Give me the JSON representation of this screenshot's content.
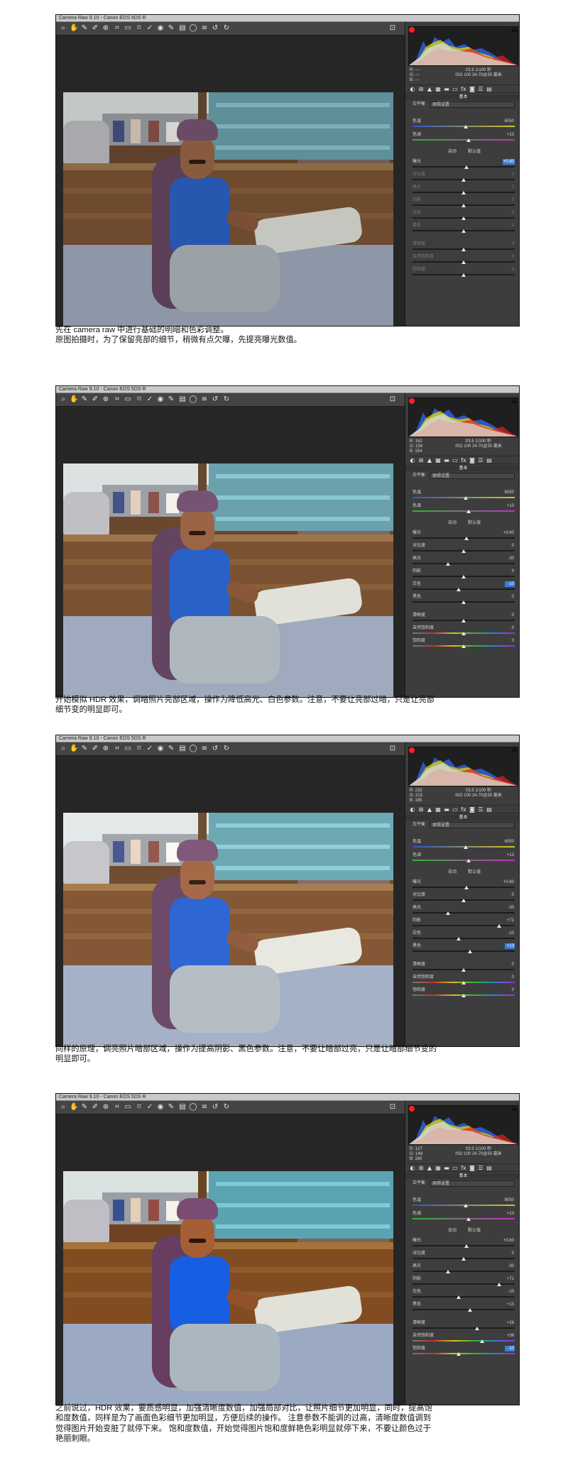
{
  "window_title": "Camera Raw 9.10 - Canon EOS 5DS R",
  "toolbar_icons": [
    "zoom-icon",
    "hand-icon",
    "white-balance-icon",
    "color-sampler-icon",
    "target-adjust-icon",
    "crop-icon",
    "straighten-icon",
    "transform-icon",
    "spot-removal-icon",
    "red-eye-icon",
    "adjustment-brush-icon",
    "graduated-filter-icon",
    "radial-filter-icon",
    "preferences-icon",
    "rotate-left-icon",
    "rotate-right-icon",
    "fullscreen-icon"
  ],
  "panel_tab_icons": [
    "basic-icon",
    "tone-curve-icon",
    "detail-icon",
    "hsl-icon",
    "split-toning-icon",
    "lens-icon",
    "effects-icon",
    "calibration-icon",
    "presets-icon",
    "snapshots-icon"
  ],
  "panel_title": "基本",
  "white_balance_label": "白平衡",
  "white_balance_value": "原照设置",
  "auto_label": "自动",
  "default_label": "默认值",
  "colors": {
    "highlight": "#3b7de0",
    "clip_warning": "#ff2020"
  },
  "sections": [
    {
      "info": {
        "r": "R: ---",
        "g": "G: ---",
        "b": "B: ---",
        "exposure": "f/3.5  1/100 秒",
        "iso": "ISO 100  24-70@35 毫米"
      },
      "sliders": [
        {
          "label": "色温",
          "value": "6050",
          "level": 0.52,
          "dim": false,
          "hl": false
        },
        {
          "label": "色调",
          "value": "+13",
          "level": 0.55,
          "dim": false,
          "hl": false
        },
        {
          "label": "曝光",
          "value": "+0.60",
          "level": 0.53,
          "dim": false,
          "hl": true
        },
        {
          "label": "对比度",
          "value": "0",
          "level": 0.5,
          "dim": true,
          "hl": false
        },
        {
          "label": "高光",
          "value": "0",
          "level": 0.5,
          "dim": true,
          "hl": false
        },
        {
          "label": "阴影",
          "value": "0",
          "level": 0.5,
          "dim": true,
          "hl": false
        },
        {
          "label": "白色",
          "value": "0",
          "level": 0.5,
          "dim": true,
          "hl": false
        },
        {
          "label": "黑色",
          "value": "0",
          "level": 0.5,
          "dim": true,
          "hl": false
        },
        {
          "label": "清晰度",
          "value": "0",
          "level": 0.5,
          "dim": true,
          "hl": false
        },
        {
          "label": "自然饱和度",
          "value": "0",
          "level": 0.5,
          "dim": true,
          "hl": false
        },
        {
          "label": "饱和度",
          "value": "0",
          "level": 0.5,
          "dim": true,
          "hl": false
        }
      ],
      "caption": "先在 camera raw 中进行基础的明暗和色彩调整。\n原图拍摄时，为了保留亮部的细节，稍微有点欠曝，先提亮曝光数值。"
    },
    {
      "info": {
        "r": "R: 162",
        "g": "G: 156",
        "b": "B: 154",
        "exposure": "f/3.5  1/100 秒",
        "iso": "ISO 100  24-70@35 毫米"
      },
      "sliders": [
        {
          "label": "色温",
          "value": "6050",
          "level": 0.52,
          "dim": false,
          "hl": false
        },
        {
          "label": "色调",
          "value": "+13",
          "level": 0.55,
          "dim": false,
          "hl": false
        },
        {
          "label": "曝光",
          "value": "+0.60",
          "level": 0.53,
          "dim": false,
          "hl": false
        },
        {
          "label": "对比度",
          "value": "0",
          "level": 0.5,
          "dim": false,
          "hl": false
        },
        {
          "label": "高光",
          "value": "-30",
          "level": 0.35,
          "dim": false,
          "hl": false
        },
        {
          "label": "阴影",
          "value": "0",
          "level": 0.5,
          "dim": false,
          "hl": false
        },
        {
          "label": "白色",
          "value": "-10",
          "level": 0.45,
          "dim": false,
          "hl": true
        },
        {
          "label": "黑色",
          "value": "0",
          "level": 0.5,
          "dim": false,
          "hl": false
        },
        {
          "label": "清晰度",
          "value": "0",
          "level": 0.5,
          "dim": false,
          "hl": false
        },
        {
          "label": "自然饱和度",
          "value": "0",
          "level": 0.5,
          "dim": false,
          "hl": false
        },
        {
          "label": "饱和度",
          "value": "0",
          "level": 0.5,
          "dim": false,
          "hl": false
        }
      ],
      "caption": "开始模拟 HDR 效果，调暗照片亮部区域，操作为降低高光、白色参数。注意，不要让亮部过暗，只是让亮部\n细节变的明显即可。"
    },
    {
      "info": {
        "r": "R: 232",
        "g": "G: 213",
        "b": "B: 185",
        "exposure": "f/3.5  1/100 秒",
        "iso": "ISO 100  24-70@35 毫米"
      },
      "sliders": [
        {
          "label": "色温",
          "value": "6050",
          "level": 0.52,
          "dim": false,
          "hl": false
        },
        {
          "label": "色调",
          "value": "+13",
          "level": 0.55,
          "dim": false,
          "hl": false
        },
        {
          "label": "曝光",
          "value": "+0.60",
          "level": 0.53,
          "dim": false,
          "hl": false
        },
        {
          "label": "对比度",
          "value": "0",
          "level": 0.5,
          "dim": false,
          "hl": false
        },
        {
          "label": "高光",
          "value": "-30",
          "level": 0.35,
          "dim": false,
          "hl": false
        },
        {
          "label": "阴影",
          "value": "+71",
          "level": 0.85,
          "dim": false,
          "hl": false
        },
        {
          "label": "白色",
          "value": "-10",
          "level": 0.45,
          "dim": false,
          "hl": false
        },
        {
          "label": "黑色",
          "value": "+13",
          "level": 0.56,
          "dim": false,
          "hl": true
        },
        {
          "label": "清晰度",
          "value": "0",
          "level": 0.5,
          "dim": false,
          "hl": false
        },
        {
          "label": "自然饱和度",
          "value": "0",
          "level": 0.5,
          "dim": false,
          "hl": false
        },
        {
          "label": "饱和度",
          "value": "0",
          "level": 0.5,
          "dim": false,
          "hl": false
        }
      ],
      "caption": "同样的原理，调亮照片暗部区域，操作为提高阴影、黑色参数。注意，不要让暗部过亮，只是让暗部细节变的\n明显即可。"
    },
    {
      "info": {
        "r": "R: 127",
        "g": "G: 148",
        "b": "B: 160",
        "exposure": "f/3.5  1/100 秒",
        "iso": "ISO 100  24-70@35 毫米"
      },
      "sliders": [
        {
          "label": "色温",
          "value": "6050",
          "level": 0.52,
          "dim": false,
          "hl": false
        },
        {
          "label": "色调",
          "value": "+13",
          "level": 0.55,
          "dim": false,
          "hl": false
        },
        {
          "label": "曝光",
          "value": "+0.60",
          "level": 0.53,
          "dim": false,
          "hl": false
        },
        {
          "label": "对比度",
          "value": "0",
          "level": 0.5,
          "dim": false,
          "hl": false
        },
        {
          "label": "高光",
          "value": "-30",
          "level": 0.35,
          "dim": false,
          "hl": false
        },
        {
          "label": "阴影",
          "value": "+71",
          "level": 0.85,
          "dim": false,
          "hl": false
        },
        {
          "label": "白色",
          "value": "-10",
          "level": 0.45,
          "dim": false,
          "hl": false
        },
        {
          "label": "黑色",
          "value": "+13",
          "level": 0.56,
          "dim": false,
          "hl": false
        },
        {
          "label": "清晰度",
          "value": "+26",
          "level": 0.63,
          "dim": false,
          "hl": false
        },
        {
          "label": "自然饱和度",
          "value": "+36",
          "level": 0.68,
          "dim": false,
          "hl": false
        },
        {
          "label": "饱和度",
          "value": "-10",
          "level": 0.45,
          "dim": false,
          "hl": true
        }
      ],
      "caption": "之前说过，HDR 效果，要质感明显，加强清晰度数值，加强局部对比，让照片细节更加明显，同时，提高饱\n和度数值，同样是为了画面色彩细节更加明显，方便后续的操作。 注意参数不能调的过高，清晰度数值调到\n觉得图片开始变脏了就停下来。 饱和度数值，开始觉得图片饱和度鲜艳色彩明显就停下来，不要让颜色过于\n艳丽刺眼。"
    }
  ]
}
